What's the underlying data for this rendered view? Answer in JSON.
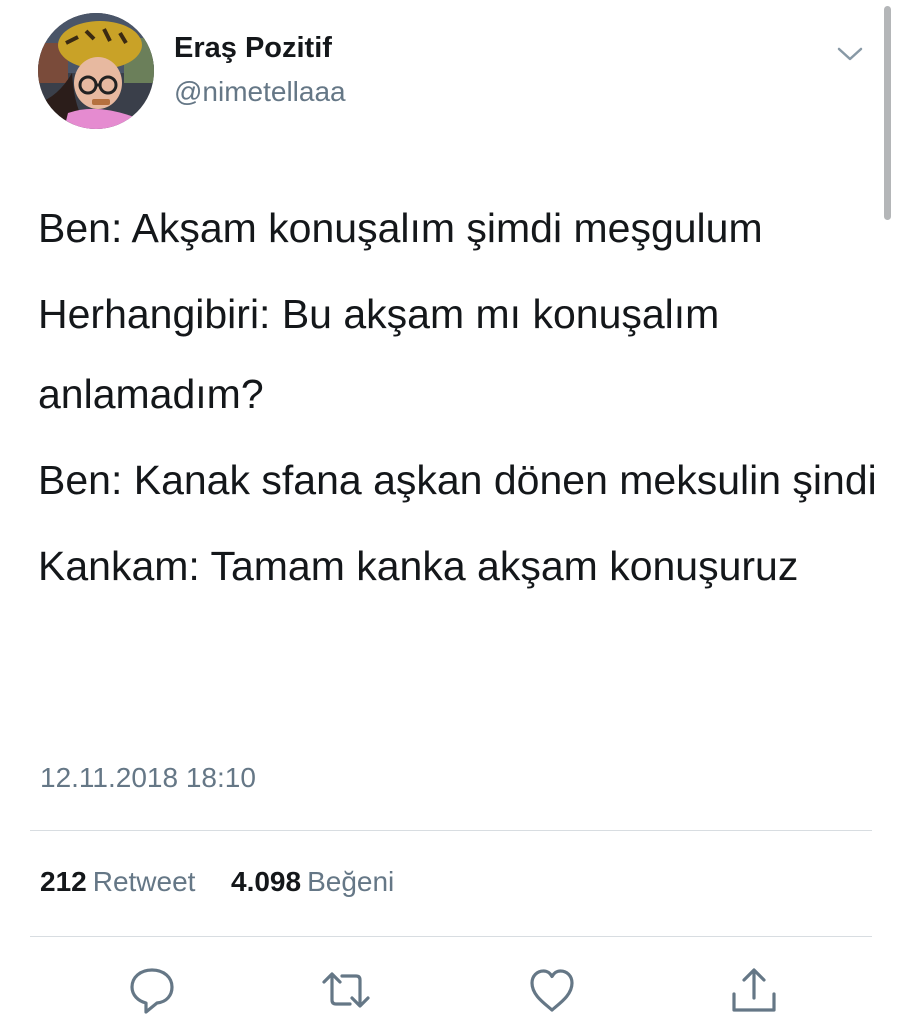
{
  "tweet": {
    "author": {
      "display_name": "Eraş Pozitif",
      "handle": "@nimetellaaa"
    },
    "text_lines": [
      "Ben: Akşam konuşalım şimdi meşgulum",
      "Herhangibiri: Bu akşam mı konuşalım anlamadım?",
      "Ben: Kanak sfana aşkan dönen meksulin şindi",
      "Kankam: Tamam kanka akşam konuşuruz"
    ],
    "timestamp": "12.11.2018 18:10",
    "stats": {
      "retweet_count": "212",
      "retweet_label": "Retweet",
      "like_count": "4.098",
      "like_label": "Beğeni"
    },
    "icons": {
      "menu": "chevron-down-icon",
      "reply": "reply-icon",
      "retweet": "retweet-icon",
      "like": "heart-icon",
      "share": "share-icon"
    }
  },
  "colors": {
    "text_primary": "#14171a",
    "text_secondary": "#657786",
    "icon": "#657786",
    "divider": "#d8dde1"
  }
}
